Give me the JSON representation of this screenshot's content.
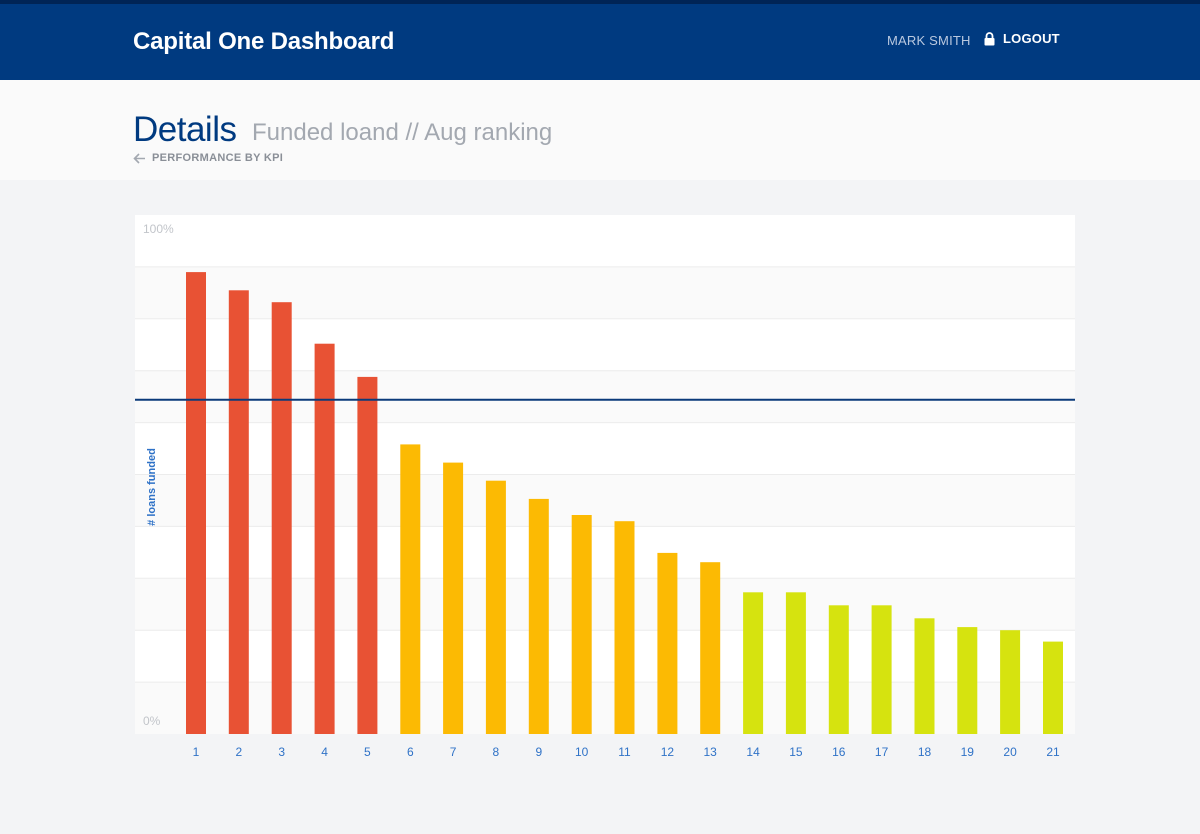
{
  "header": {
    "app_title": "Capital One Dashboard",
    "user_name": "MARK SMITH",
    "logout_label": "LOGOUT",
    "lock_icon": "lock-icon"
  },
  "page": {
    "title": "Details",
    "subtitle": "Funded loand // Aug ranking",
    "breadcrumb_icon": "arrow-left-icon",
    "breadcrumb_label": "PERFORMANCE BY KPI"
  },
  "colors": {
    "header_bg": "#003a80",
    "red": "#e85234",
    "orange": "#fcba03",
    "lime": "#d6e30f",
    "target_line": "#0b3a7a",
    "tick_label": "#2f72c7"
  },
  "chart_data": {
    "type": "bar",
    "ylabel": "# loans funded",
    "ytick_top": "100%",
    "ytick_bottom": "0%",
    "ylim": [
      0,
      100
    ],
    "grid": true,
    "target_line": 64.4,
    "categories": [
      "1",
      "2",
      "3",
      "4",
      "5",
      "6",
      "7",
      "8",
      "9",
      "10",
      "11",
      "12",
      "13",
      "14",
      "15",
      "16",
      "17",
      "18",
      "19",
      "20",
      "21"
    ],
    "values": [
      89.0,
      85.5,
      83.2,
      75.2,
      68.8,
      55.8,
      52.3,
      48.8,
      45.3,
      42.2,
      41.0,
      34.9,
      33.1,
      27.3,
      27.3,
      24.8,
      24.8,
      22.3,
      20.6,
      20.0,
      17.8
    ],
    "bar_color_groups": [
      "red",
      "red",
      "red",
      "red",
      "red",
      "orange",
      "orange",
      "orange",
      "orange",
      "orange",
      "orange",
      "orange",
      "orange",
      "lime",
      "lime",
      "lime",
      "lime",
      "lime",
      "lime",
      "lime",
      "lime"
    ]
  }
}
